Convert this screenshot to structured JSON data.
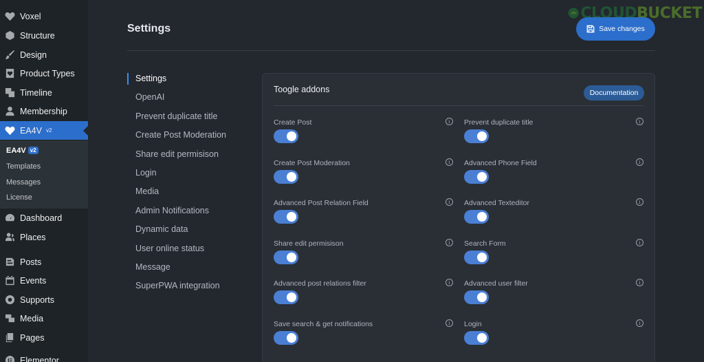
{
  "sidebar": {
    "items": [
      {
        "label": "Voxel",
        "icon": "voxel-heart-icon"
      },
      {
        "label": "Structure",
        "icon": "cube-icon"
      },
      {
        "label": "Design",
        "icon": "brush-icon"
      },
      {
        "label": "Product Types",
        "icon": "heart-box-icon"
      },
      {
        "label": "Timeline",
        "icon": "timeline-icon"
      },
      {
        "label": "Membership",
        "icon": "user-icon"
      },
      {
        "label": "EA4V",
        "icon": "voxel-heart-icon",
        "badge": "v2"
      },
      {
        "label": "Dashboard",
        "icon": "dashboard-icon"
      },
      {
        "label": "Places",
        "icon": "people-icon"
      },
      {
        "label": "Posts",
        "icon": "posts-icon"
      },
      {
        "label": "Events",
        "icon": "calendar-icon"
      },
      {
        "label": "Supports",
        "icon": "support-icon"
      },
      {
        "label": "Media",
        "icon": "media-icon"
      },
      {
        "label": "Pages",
        "icon": "pages-icon"
      },
      {
        "label": "Elementor",
        "icon": "elementor-icon"
      }
    ],
    "submenu": [
      {
        "label": "EA4V",
        "badge": "v2"
      },
      {
        "label": "Templates"
      },
      {
        "label": "Messages"
      },
      {
        "label": "License"
      }
    ],
    "colors": {
      "background": "#1d2327",
      "active": "#2c6ecb"
    }
  },
  "header": {
    "title": "Settings",
    "save_label": "Save changes"
  },
  "watermark": {
    "brand_a": "CLOUD",
    "brand_b": "BUCKET"
  },
  "settings_nav": {
    "items": [
      "Settings",
      "OpenAI",
      "Prevent duplicate title",
      "Create Post Moderation",
      "Share edit permisison",
      "Login",
      "Media",
      "Admin Notifications",
      "Dynamic data",
      "User online status",
      "Message",
      "SuperPWA integration"
    ],
    "active_index": 0
  },
  "panel": {
    "title": "Toogle addons",
    "doc_label": "Documentation",
    "addons": [
      {
        "label": "Create Post",
        "enabled": true
      },
      {
        "label": "Prevent duplicate title",
        "enabled": true
      },
      {
        "label": "Create Post Moderation",
        "enabled": true
      },
      {
        "label": "Advanced Phone Field",
        "enabled": true
      },
      {
        "label": "Advanced Post Relation Field",
        "enabled": true
      },
      {
        "label": "Advanced Texteditor",
        "enabled": true
      },
      {
        "label": "Share edit permisison",
        "enabled": true
      },
      {
        "label": "Search Form",
        "enabled": true
      },
      {
        "label": "Advanced post relations filter",
        "enabled": true
      },
      {
        "label": "Advanced user filter",
        "enabled": true
      },
      {
        "label": "Save search & get notifications",
        "enabled": true
      },
      {
        "label": "Login",
        "enabled": true
      }
    ]
  },
  "colors": {
    "page_background": "#23272e",
    "accent": "#2c6ecb",
    "toggle_on": "#4a7fd4"
  }
}
